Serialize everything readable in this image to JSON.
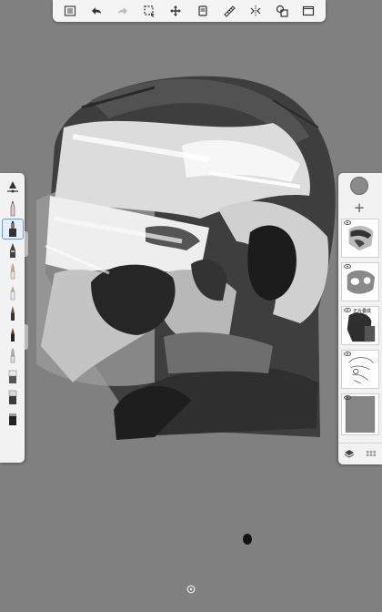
{
  "app": {
    "name": ""
  },
  "toolbar": {
    "items": [
      {
        "id": "gallery",
        "icon": "gallery-icon"
      },
      {
        "id": "undo",
        "icon": "undo-icon"
      },
      {
        "id": "redo",
        "icon": "redo-icon",
        "enabled": false
      },
      {
        "id": "selection",
        "icon": "selection-icon"
      },
      {
        "id": "transform",
        "icon": "transform-icon"
      },
      {
        "id": "layer-copy",
        "icon": "layer-icon"
      },
      {
        "id": "ruler",
        "icon": "ruler-icon"
      },
      {
        "id": "symmetry",
        "icon": "symmetry-icon"
      },
      {
        "id": "shapes",
        "icon": "shapes-icon"
      },
      {
        "id": "fullscreen",
        "icon": "fullscreen-icon"
      }
    ]
  },
  "brushes": {
    "selected_index": 2,
    "items": [
      "brush-settings-icon",
      "pencil-icon",
      "airbrush-icon",
      "marker-icon",
      "paintbrush-icon",
      "chisel-icon",
      "ink-pen-icon",
      "felt-pen-icon",
      "smudge-icon",
      "eraser-icon",
      "fill-icon",
      "stamp-icon"
    ]
  },
  "layers": {
    "current_color": "#8a8a8a",
    "items": [
      {
        "name": "layer-1",
        "visible": true,
        "badge": ""
      },
      {
        "name": "layer-2",
        "visible": true,
        "badge": ""
      },
      {
        "name": "layer-3",
        "visible": true,
        "badge": "正片叠底"
      },
      {
        "name": "layer-4",
        "visible": true,
        "badge": ""
      },
      {
        "name": "background-layer",
        "visible": true,
        "badge": ""
      }
    ]
  },
  "colors": {
    "canvas_bg": "#808080",
    "panel_bg": "#f2f2f2",
    "accent": "#6b9ed8"
  }
}
